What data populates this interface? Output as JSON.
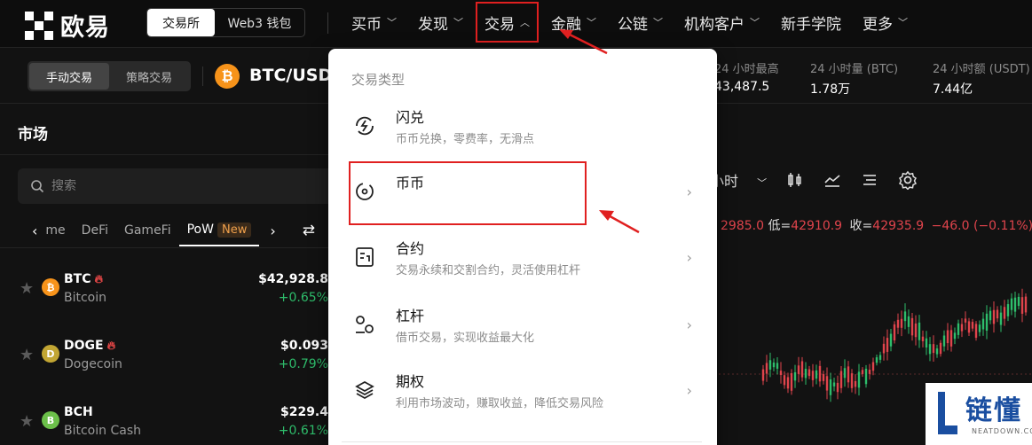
{
  "nav": {
    "logo_text": "欧易",
    "switch": {
      "exchange": "交易所",
      "wallet": "Web3 钱包"
    },
    "items": [
      {
        "label": "买币",
        "has_dropdown": true
      },
      {
        "label": "发现",
        "has_dropdown": true
      },
      {
        "label": "交易",
        "has_dropdown": true,
        "expanded": true
      },
      {
        "label": "金融",
        "has_dropdown": true
      },
      {
        "label": "公链",
        "has_dropdown": true
      },
      {
        "label": "机构客户",
        "has_dropdown": true
      },
      {
        "label": "新手学院",
        "has_dropdown": false
      },
      {
        "label": "更多",
        "has_dropdown": true
      }
    ]
  },
  "ticker": {
    "mode_manual": "手动交易",
    "mode_strategy": "策略交易",
    "coin_symbol": "₿",
    "pair": "BTC/USDT",
    "stats": [
      {
        "label": "24 小时最高",
        "value": "43,487.5"
      },
      {
        "label": "24 小时量 (BTC)",
        "value": "1.78万"
      },
      {
        "label": "24 小时额 (USDT)",
        "value": "7.44亿"
      }
    ]
  },
  "market": {
    "title": "市场",
    "search_placeholder": "搜索",
    "categories": [
      {
        "label": "me",
        "active": false
      },
      {
        "label": "DeFi",
        "active": false
      },
      {
        "label": "GameFi",
        "active": false
      },
      {
        "label": "PoW",
        "active": true,
        "badge": "New"
      }
    ],
    "coins": [
      {
        "symbol": "BTC",
        "name": "Bitcoin",
        "price": "$42,928.8",
        "change": "+0.65%",
        "color": "#f7931a",
        "glyph": "₿",
        "hot": true
      },
      {
        "symbol": "DOGE",
        "name": "Dogecoin",
        "price": "$0.093",
        "change": "+0.79%",
        "color": "#c2a633",
        "glyph": "D",
        "hot": true
      },
      {
        "symbol": "BCH",
        "name": "Bitcoin Cash",
        "price": "$229.4",
        "change": "+0.61%",
        "color": "#6cc04a",
        "glyph": "B",
        "hot": false
      }
    ]
  },
  "chart": {
    "interval": "小时",
    "ohlc": {
      "high_tail": "2985.0",
      "low_label": "低=",
      "low": "42910.9",
      "close_label": "收=",
      "close": "42935.9",
      "change": "−46.0 (−0.11%)"
    }
  },
  "dropdown": {
    "header": "交易类型",
    "items": [
      {
        "title": "闪兑",
        "desc": "币币兑换，零费率，无滑点",
        "icon": "flash-swap-icon",
        "has_arrow": false
      },
      {
        "title": "币币",
        "desc": "",
        "icon": "spot-icon",
        "has_arrow": true
      },
      {
        "title": "合约",
        "desc": "交易永续和交割合约，灵活使用杠杆",
        "icon": "contract-icon",
        "has_arrow": true
      },
      {
        "title": "杠杆",
        "desc": "借币交易，实现收益最大化",
        "icon": "margin-icon",
        "has_arrow": true
      },
      {
        "title": "期权",
        "desc": "利用市场波动，赚取收益，降低交易风险",
        "icon": "options-icon",
        "has_arrow": true
      }
    ]
  },
  "watermark": {
    "text": "链懂",
    "sub": "NEATDOWN.COM"
  },
  "colors": {
    "up": "#2ebd6b",
    "down": "#e0444c",
    "annotation": "#e02020",
    "badge": "#f0a04b"
  }
}
